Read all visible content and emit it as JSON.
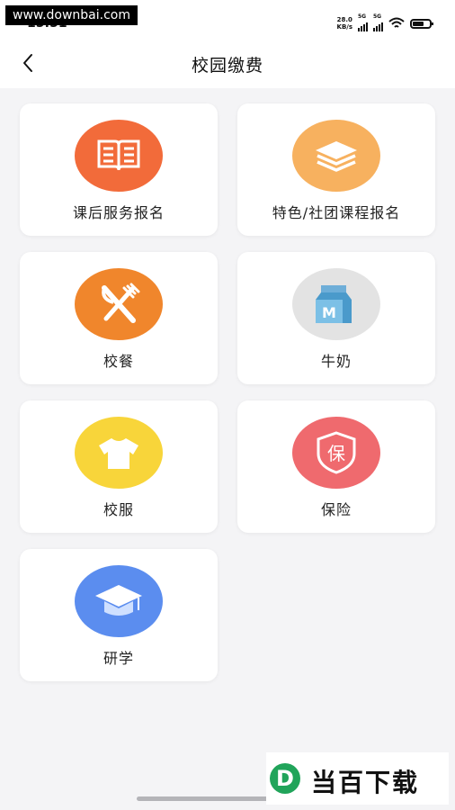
{
  "status_bar": {
    "time": "15:51",
    "watermark": "www.downbai.com",
    "net_speed_value": "28.0",
    "net_speed_unit": "KB/s",
    "sim1": "5G",
    "sim2": "5G"
  },
  "nav": {
    "title": "校园缴费"
  },
  "items": [
    {
      "label": "课后服务报名",
      "icon": "book-icon",
      "color": "#f26b3a"
    },
    {
      "label": "特色/社团课程报名",
      "icon": "layers-icon",
      "color": "#f7b15f"
    },
    {
      "label": "校餐",
      "icon": "fork-knife-icon",
      "color": "#f0862c"
    },
    {
      "label": "牛奶",
      "icon": "milk-carton-icon",
      "color": "#e3e3e3"
    },
    {
      "label": "校服",
      "icon": "tshirt-icon",
      "color": "#f8d53a"
    },
    {
      "label": "保险",
      "icon": "insurance-shield-icon",
      "color": "#ef6a6e",
      "glyph": "保"
    },
    {
      "label": "研学",
      "icon": "graduation-cap-icon",
      "color": "#5b8def"
    }
  ],
  "footer": {
    "logo_letter": "D",
    "logo_text": "当百下载"
  }
}
